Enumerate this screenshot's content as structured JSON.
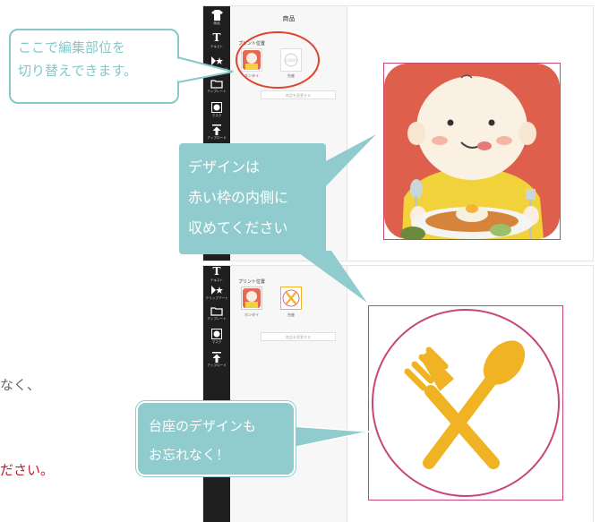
{
  "colors": {
    "sidebar": "#1f1f1f",
    "callout_fill": "#90cccd",
    "callout_border": "#86c7c8",
    "print_frame": "#c8467a",
    "highlight_circle": "#e0442c",
    "utensil": "#f0b323",
    "partial_red_text": "#c0162c"
  },
  "top_screen": {
    "panel_title": "商品",
    "print_position_label": "プリント位置",
    "thumb_front_label": "ホンタイ",
    "thumb_base_label": "台座",
    "change_button": "商品を変更する",
    "sidebar_items": [
      {
        "label": "商品",
        "icon": "tshirt-icon"
      },
      {
        "label": "テキスト",
        "icon": "text-icon"
      },
      {
        "label": "クリップアート",
        "icon": "clipart-icon"
      },
      {
        "label": "テンプレート",
        "icon": "folder-icon"
      },
      {
        "label": "マスク",
        "icon": "mask-icon"
      },
      {
        "label": "アップロード",
        "icon": "upload-icon"
      }
    ]
  },
  "bottom_screen": {
    "print_position_label": "プリント位置",
    "thumb_front_label": "ホンタイ",
    "thumb_base_label": "台座",
    "change_button": "商品を変更する",
    "sidebar_items": [
      {
        "label": "テキスト",
        "icon": "text-icon"
      },
      {
        "label": "クリップアート",
        "icon": "clipart-icon"
      },
      {
        "label": "テンプレート",
        "icon": "folder-icon"
      },
      {
        "label": "マスク",
        "icon": "mask-icon"
      },
      {
        "label": "アップロード",
        "icon": "upload-icon"
      }
    ]
  },
  "callouts": {
    "switch_part": [
      "ここで編集部位を",
      "切り替えできます。"
    ],
    "inside_frame": [
      "デザインは",
      "赤い枠の内側に",
      "収めてください"
    ],
    "base_reminder": [
      "台座のデザインも",
      "お忘れなく！"
    ]
  },
  "partial_texts": {
    "line1": "なく、",
    "line2": "ださい。"
  }
}
